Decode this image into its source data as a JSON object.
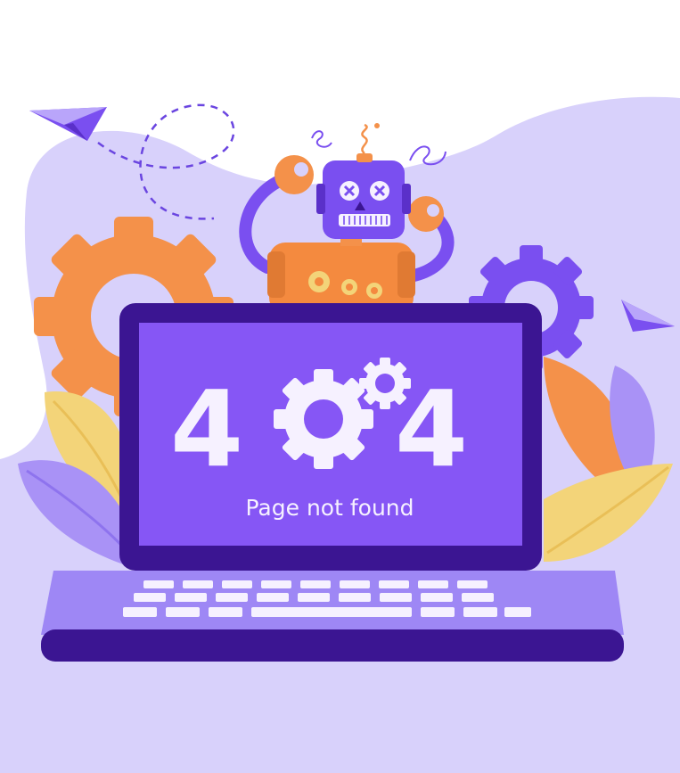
{
  "error": {
    "digit_left": "4",
    "digit_right": "4",
    "message": "Page not found"
  },
  "palette": {
    "background_light": "#ffffff",
    "blob_lavender": "#d8d1fb",
    "screen_purple": "#8656f5",
    "laptop_dark": "#3b1592",
    "laptop_deck": "#9e87f5",
    "gear_orange": "#f4914a",
    "robot_body_orange": "#f48a3f",
    "gear_purple": "#7a4ff0",
    "leaf_yellow": "#f3d479",
    "leaf_lavender": "#a992f6",
    "text_white": "#f6f1ff"
  },
  "icons": [
    "paper-plane-icon",
    "gear-icon",
    "robot-illustration",
    "laptop-illustration"
  ]
}
